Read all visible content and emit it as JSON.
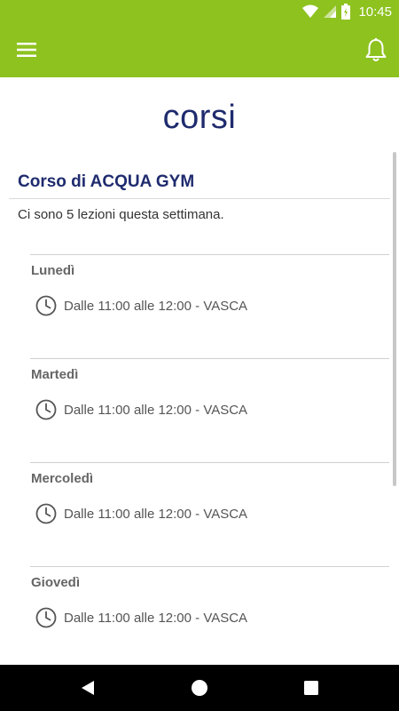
{
  "status_bar": {
    "time": "10:45",
    "icons": [
      "wifi-icon",
      "signal-icon",
      "battery-icon"
    ]
  },
  "app_bar": {
    "menu_icon": "hamburger-menu-icon",
    "notification_icon": "bell-icon",
    "color": "#8dc21f"
  },
  "page": {
    "title": "corsi"
  },
  "course": {
    "title": "Corso di ACQUA GYM",
    "info": "Ci sono 5 lezioni questa settimana."
  },
  "lessons": [
    {
      "day": "Lunedì",
      "time": "Dalle 11:00 alle 12:00 - VASCA"
    },
    {
      "day": "Martedì",
      "time": "Dalle 11:00 alle 12:00 - VASCA"
    },
    {
      "day": "Mercoledì",
      "time": "Dalle 11:00 alle 12:00 - VASCA"
    },
    {
      "day": "Giovedì",
      "time": "Dalle 11:00 alle 12:00 - VASCA"
    }
  ],
  "nav_bar": {
    "back": "back-icon",
    "home": "home-icon",
    "recents": "recents-icon"
  },
  "colors": {
    "accent": "#8dc21f",
    "title": "#1f2b6e"
  }
}
